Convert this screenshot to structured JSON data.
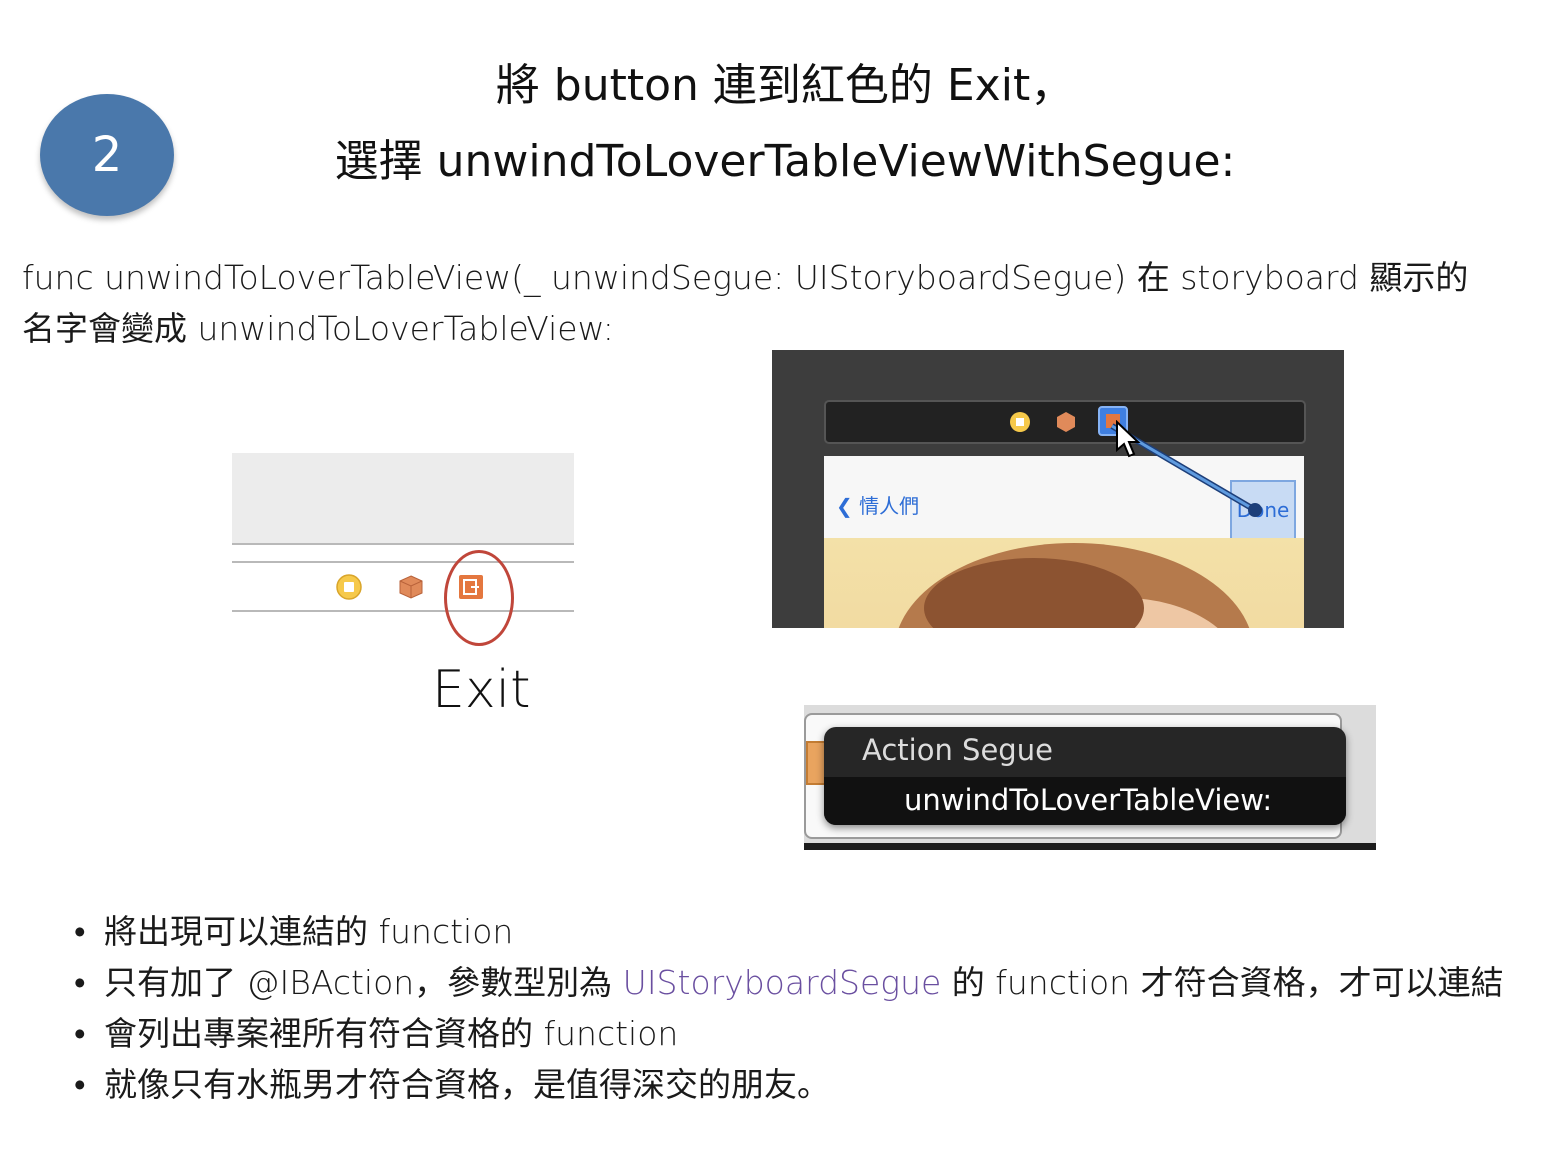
{
  "step_number": "2",
  "title": {
    "line1": "將 button 連到紅色的 Exit，",
    "line2": "選擇 unwindToLoverTableViewWithSegue:"
  },
  "description": {
    "line1": "func unwindToLoverTableView(_ unwindSegue: UIStoryboardSegue) 在 storyboard 顯示的",
    "line2": "名字會變成 unwindToLoverTableView:"
  },
  "exit_panel": {
    "label": "Exit",
    "icons": [
      "view-controller-icon",
      "first-responder-icon",
      "exit-icon"
    ],
    "highlight_color": "#c0463a"
  },
  "storyboard": {
    "back_label": "情人們",
    "done_label": "Done",
    "icons": [
      "view-controller-icon",
      "first-responder-icon",
      "exit-icon",
      "cursor-icon"
    ]
  },
  "action_segue_menu": {
    "header": "Action Segue",
    "item": "unwindToLoverTableView:"
  },
  "bullets": [
    {
      "dot": "•",
      "text": "將出現可以連結的 function"
    },
    {
      "dot": "•",
      "before": "只有加了 @IBAction，參數型別為 ",
      "highlight": "UIStoryboardSegue",
      "after": "  的 function 才符合資格，才可以連結",
      "highlight_color": "#6a4fa0"
    },
    {
      "dot": "•",
      "text": "會列出專案裡所有符合資格的 function"
    },
    {
      "dot": "•",
      "text": "就像只有水瓶男才符合資格，是值得深交的朋友。"
    }
  ]
}
